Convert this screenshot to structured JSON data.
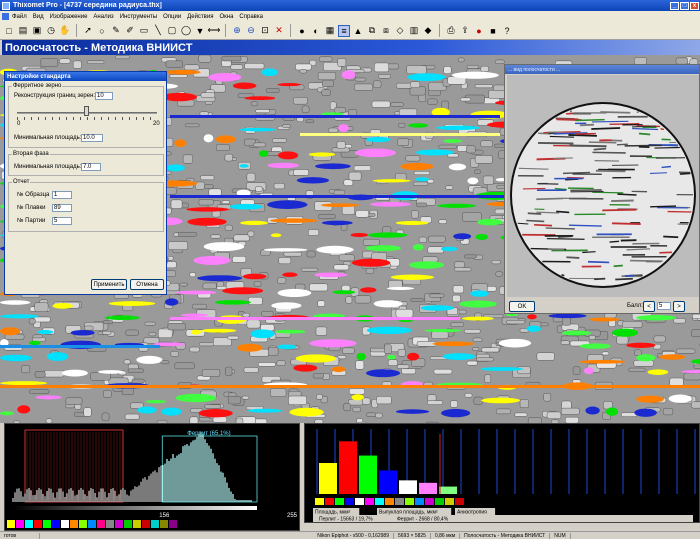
{
  "window": {
    "title": "Thixomet Pro - [4737 середина радиуса.thx]",
    "min_label": "_",
    "max_label": "□",
    "close_label": "x"
  },
  "menu": {
    "items": [
      "Файл",
      "Вид",
      "Изображение",
      "Анализ",
      "Инструменты",
      "Опции",
      "Действия",
      "Окна",
      "Справка"
    ]
  },
  "toolbar": {
    "icons": [
      "new-icon",
      "open-icon",
      "save-icon",
      "timer-icon",
      "hand-icon",
      "pointer-icon",
      "circle-icon",
      "brush-icon",
      "pen-icon",
      "eraser-icon",
      "line-icon",
      "rect-icon",
      "ellipse-icon",
      "fill-icon",
      "measure-icon",
      "zoom-in-icon",
      "zoom-out-icon",
      "zoom-fit-icon",
      "delete-icon",
      "color-icon",
      "threshold-icon",
      "grid-icon",
      "stripe-icon",
      "sample-icon",
      "merge-icon",
      "split-icon",
      "contour-icon",
      "layer-icon",
      "palette-icon",
      "print-icon",
      "export-icon",
      "record-icon",
      "stop-icon",
      "help-icon"
    ]
  },
  "module": {
    "title": "Полосчатость - Методика ВНИИСТ"
  },
  "settings_dialog": {
    "title": "Настройки стандарта",
    "ferrite_group": "Ферритное зерно",
    "reconstruct_label": "Реконструкция границ зерен:",
    "reconstruct_value": "10",
    "slider_min": "0",
    "slider_max": "20",
    "slider_value": 10,
    "min_area_label": "Минимальная площадь:",
    "min_area_value": "10.0",
    "second_phase_group": "Вторая фаза",
    "second_min_area_label": "Минимальная площадь:",
    "second_min_area_value": "7.0",
    "report_group": "Отчет",
    "sample_label": "№ Образца",
    "sample_value": "1",
    "heat_label": "№ Плавки",
    "heat_value": "89",
    "batch_label": "№ Партии",
    "batch_value": "5",
    "apply_label": "Применить",
    "cancel_label": "Отмена"
  },
  "viewer": {
    "title": "... вид полосчатости ...",
    "ok_label": "OK",
    "zoom_label": "Балл:",
    "zoom_value": "5",
    "prev_label": "<",
    "next_label": ">"
  },
  "histogram": {
    "ferrite_label": "Феррит (65,1%)",
    "tick_156": "156",
    "tick_255": "255",
    "cursor_value": 156
  },
  "bar_panel": {
    "tab1": "Площадь, мкм²",
    "tab2": "Выпуклая площадь, мкм²",
    "tab3": "Анизотропия",
    "perlite_label": "Перлит - 15663 / 19,7%",
    "ferrite_label": "Феррит - 2668 / 80,4%",
    "bar_colors": [
      "#ffff00",
      "#ff0000",
      "#00ff00",
      "#0000ff",
      "#ffffff",
      "#ff80ff",
      "#80ff80"
    ],
    "bar_values": [
      0.5,
      0.85,
      0.62,
      0.38,
      0.22,
      0.18,
      0.12
    ]
  },
  "status": {
    "mode": "готов",
    "camera": "Nikon Epiphot - x500 - 0,162989",
    "size": "5693 × 5825",
    "scale": "0,86 мкм",
    "method": "Полосчатость - Методика ВНИИСТ",
    "extra": "NUM"
  },
  "colors": {
    "title_blue": "#0a2c9a",
    "ferrite_cyan": "#80e0e0",
    "perlite_red": "#c03030"
  }
}
